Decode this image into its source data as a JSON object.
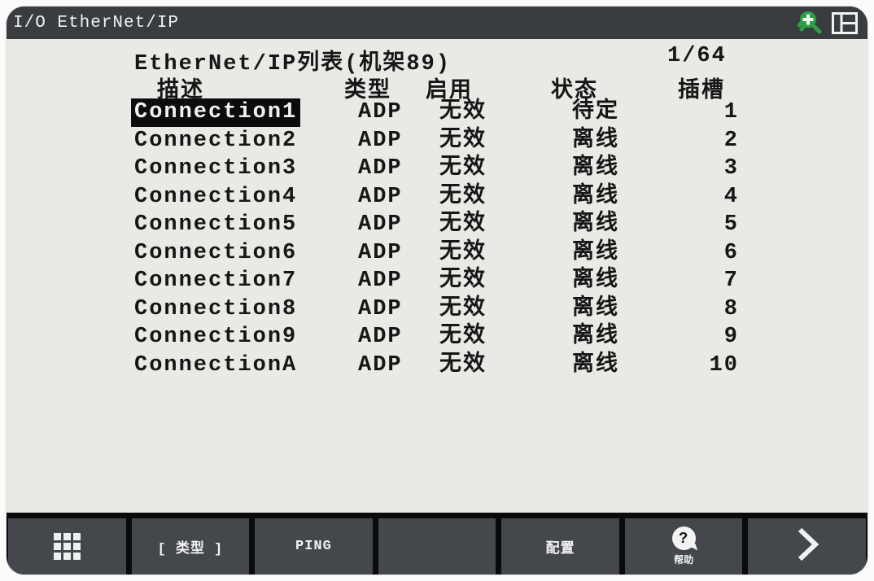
{
  "window": {
    "title": "I/O EtherNet/IP",
    "icons": [
      {
        "name": "zoom-in-icon",
        "color": "#2f9e44"
      },
      {
        "name": "split-screen-icon",
        "color": "#f2f2f2"
      }
    ]
  },
  "list": {
    "title": "EtherNet/IP列表(机架89)",
    "page_indicator": "1/64",
    "headers": {
      "desc": "描述",
      "type": "类型",
      "enable": "启用",
      "status": "状态",
      "slot": "插槽"
    },
    "rows": [
      {
        "desc": "Connection1",
        "type": "ADP",
        "enable": "无效",
        "status": "待定",
        "slot": "1",
        "selected": true
      },
      {
        "desc": "Connection2",
        "type": "ADP",
        "enable": "无效",
        "status": "离线",
        "slot": "2",
        "selected": false
      },
      {
        "desc": "Connection3",
        "type": "ADP",
        "enable": "无效",
        "status": "离线",
        "slot": "3",
        "selected": false
      },
      {
        "desc": "Connection4",
        "type": "ADP",
        "enable": "无效",
        "status": "离线",
        "slot": "4",
        "selected": false
      },
      {
        "desc": "Connection5",
        "type": "ADP",
        "enable": "无效",
        "status": "离线",
        "slot": "5",
        "selected": false
      },
      {
        "desc": "Connection6",
        "type": "ADP",
        "enable": "无效",
        "status": "离线",
        "slot": "6",
        "selected": false
      },
      {
        "desc": "Connection7",
        "type": "ADP",
        "enable": "无效",
        "status": "离线",
        "slot": "7",
        "selected": false
      },
      {
        "desc": "Connection8",
        "type": "ADP",
        "enable": "无效",
        "status": "离线",
        "slot": "8",
        "selected": false
      },
      {
        "desc": "Connection9",
        "type": "ADP",
        "enable": "无效",
        "status": "离线",
        "slot": "9",
        "selected": false
      },
      {
        "desc": "ConnectionA",
        "type": "ADP",
        "enable": "无效",
        "status": "离线",
        "slot": "10",
        "selected": false
      }
    ]
  },
  "function_keys": {
    "menu": {
      "label": "",
      "icon": "grid-menu-icon"
    },
    "type": {
      "label": "[ 类型 ]"
    },
    "ping": {
      "label": "PING"
    },
    "blank": {
      "label": ""
    },
    "config": {
      "label": "配置"
    },
    "help": {
      "label": "帮助",
      "icon": "help-question-icon"
    },
    "next": {
      "label": "",
      "icon": "chevron-right-icon"
    }
  },
  "colors": {
    "titlebar": "#3a3d40",
    "body_bg": "#e9e9e6",
    "text": "#161616",
    "highlight_bg": "#0c0c0c",
    "highlight_text": "#f2f2f2",
    "fkey_button": "#44474c",
    "fkey_gap": "#0a0a0a",
    "accent_green": "#2f9e44"
  }
}
